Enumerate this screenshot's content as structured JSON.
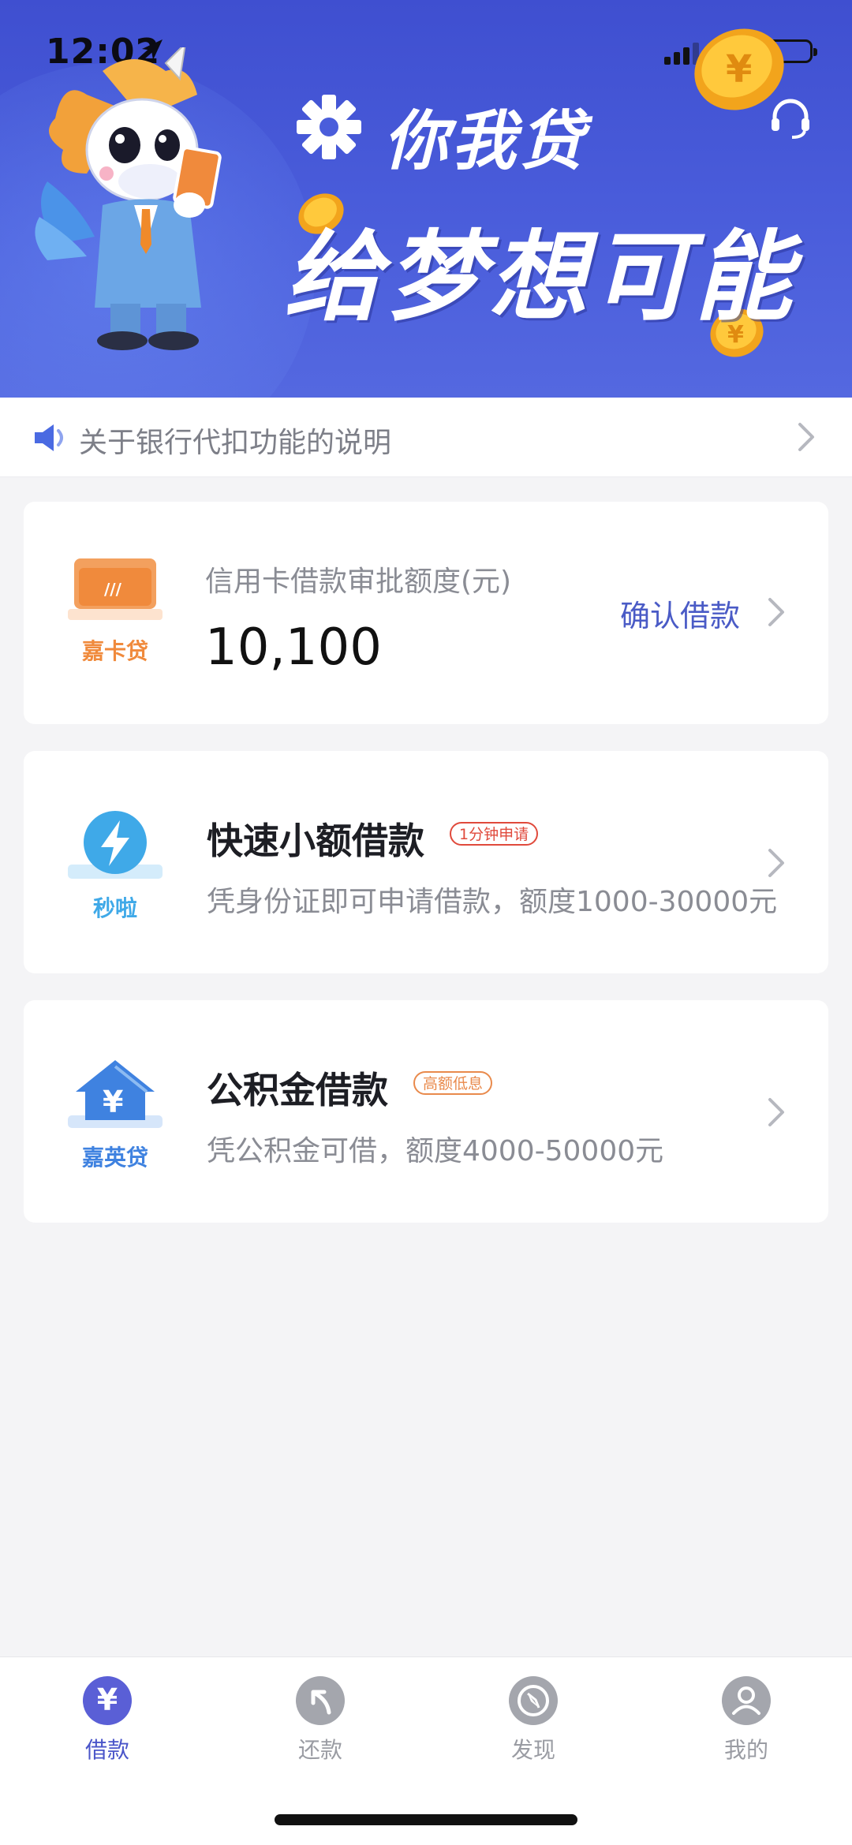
{
  "status_bar": {
    "time": "12:02",
    "battery_color": "#f2c21a"
  },
  "banner": {
    "brand": "你我贷",
    "slogan": "给梦想可能",
    "colors": {
      "bg_top": "#3f4fd0",
      "bg_bottom": "#5468e0",
      "coin": "#f0a21a"
    },
    "icons": {
      "customer_service": "headset-icon"
    }
  },
  "notice": {
    "text": "关于银行代扣功能的说明",
    "icon": "speaker-icon"
  },
  "cards": [
    {
      "icon_label": "嘉卡贷",
      "icon_color": "#f08a3c",
      "subtitle": "信用卡借款审批额度(元)",
      "amount": "10,100",
      "action": "确认借款"
    },
    {
      "icon_label": "秒啦",
      "icon_color": "#3fa9e8",
      "title": "快速小额借款",
      "tag": "1分钟申请",
      "tag_color": "#e04a3c",
      "description": "凭身份证即可申请借款，额度1000-30000元"
    },
    {
      "icon_label": "嘉英贷",
      "icon_color": "#3f82e0",
      "icon_glyph": "¥",
      "title": "公积金借款",
      "tag": "高额低息",
      "tag_color": "#e98a4c",
      "description": "凭公积金可借，额度4000-50000元"
    }
  ],
  "tabbar": {
    "active_color": "#5a5fd6",
    "inactive_color": "#a4a6ad",
    "tabs": [
      {
        "label": "借款",
        "icon": "yuan-icon",
        "glyph": "¥",
        "active": true
      },
      {
        "label": "还款",
        "icon": "return-arrow-icon",
        "active": false
      },
      {
        "label": "发现",
        "icon": "compass-icon",
        "active": false
      },
      {
        "label": "我的",
        "icon": "profile-icon",
        "active": false
      }
    ]
  }
}
